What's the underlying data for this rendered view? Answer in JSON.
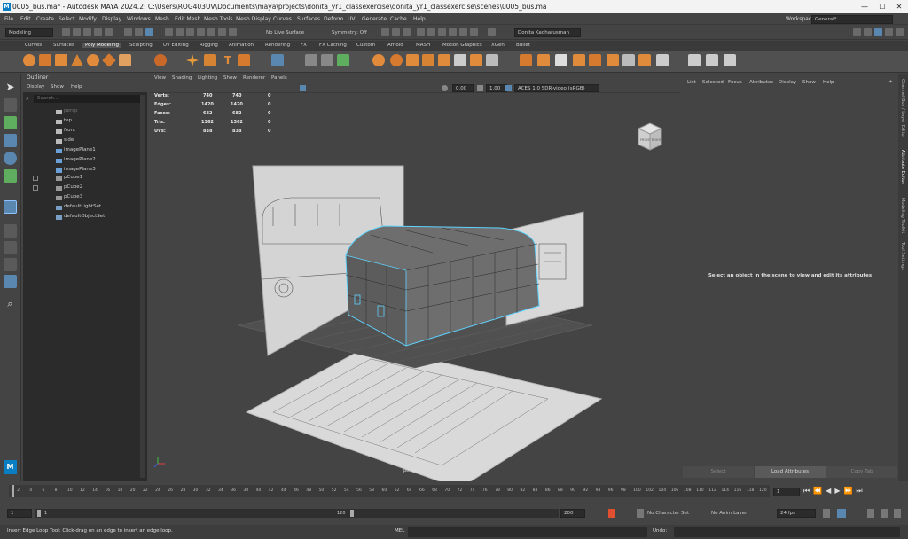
{
  "titlebar": {
    "title": "0005_bus.ma* - Autodesk MAYA 2024.2: C:\\Users\\ROG403UV\\Documents\\maya\\projects\\donita_yr1_classexercise\\donita_yr1_classexercise\\scenes\\0005_bus.ma",
    "logo": "M",
    "minimize": "—",
    "maximize": "☐",
    "close": "✕"
  },
  "menubar": {
    "items": [
      "File",
      "Edit",
      "Create",
      "Select",
      "Modify",
      "Display",
      "Windows",
      "Mesh",
      "Edit Mesh",
      "Mesh Tools",
      "Mesh Display",
      "Curves",
      "Surfaces",
      "Deform",
      "UV",
      "Generate",
      "Cache",
      "Help"
    ],
    "workspace_label": "Workspace:",
    "workspace_value": "General*"
  },
  "statusline": {
    "mode": "Modeling",
    "live_surface": "No Live Surface",
    "symmetry": "Symmetry: Off",
    "user": "Donita Kadharusman"
  },
  "shelf_tabs": [
    "Curves",
    "Surfaces",
    "Poly Modeling",
    "Sculpting",
    "UV Editing",
    "Rigging",
    "Animation",
    "Rendering",
    "FX",
    "FX Caching",
    "Custom",
    "Arnold",
    "MASH",
    "Motion Graphics",
    "XGen",
    "Bullet"
  ],
  "outliner": {
    "title": "Outliner",
    "menu": [
      "Display",
      "Show",
      "Help"
    ],
    "search_placeholder": "Search...",
    "items": [
      "persp",
      "top",
      "front",
      "side",
      "imagePlane1",
      "imagePlane2",
      "imagePlane3",
      "pCube1",
      "pCube2",
      "pCube3",
      "defaultLightSet",
      "defaultObjectSet"
    ]
  },
  "viewport": {
    "menu": [
      "View",
      "Shading",
      "Lighting",
      "Show",
      "Renderer",
      "Panels"
    ],
    "exposure": "0.00",
    "gamma": "1.00",
    "color_space": "ACES 1.0 SDR-video (sRGB)",
    "camera_label": "persp",
    "viewcube_front": "FRONT",
    "viewcube_right": "RIGHT",
    "hud": [
      {
        "label": "Verts:",
        "a": "740",
        "b": "740",
        "c": "0"
      },
      {
        "label": "Edges:",
        "a": "1420",
        "b": "1420",
        "c": "0"
      },
      {
        "label": "Faces:",
        "a": "682",
        "b": "682",
        "c": "0"
      },
      {
        "label": "Tris:",
        "a": "1362",
        "b": "1362",
        "c": "0"
      },
      {
        "label": "UVs:",
        "a": "838",
        "b": "838",
        "c": "0"
      }
    ]
  },
  "attribute_editor": {
    "menu": [
      "List",
      "Selected",
      "Focus",
      "Attributes",
      "Display",
      "Show",
      "Help"
    ],
    "message": "Select an object in the scene to view and edit its attributes",
    "buttons": [
      "Select",
      "Load Attributes",
      "Copy Tab"
    ]
  },
  "right_tabs": [
    "Channel Box / Layer Editor",
    "Attribute Editor",
    "Modeling Toolkit",
    "Tool Settings"
  ],
  "timeslider": {
    "ticks": [
      "1",
      "2",
      "4",
      "6",
      "8",
      "10",
      "12",
      "14",
      "16",
      "18",
      "20",
      "22",
      "24",
      "26",
      "28",
      "30",
      "32",
      "34",
      "36",
      "38",
      "40",
      "42",
      "44",
      "46",
      "48",
      "50",
      "52",
      "54",
      "56",
      "58",
      "60",
      "62",
      "64",
      "66",
      "68",
      "70",
      "72",
      "74",
      "76",
      "78",
      "80",
      "82",
      "84",
      "86",
      "88",
      "90",
      "92",
      "94",
      "96",
      "98",
      "100",
      "102",
      "104",
      "106",
      "108",
      "110",
      "112",
      "114",
      "116",
      "118",
      "120"
    ],
    "current_frame": "1"
  },
  "rangeslider": {
    "start": "1",
    "inner_start": "1",
    "inner_end": "120",
    "end": "200",
    "character_set": "No Character Set",
    "anim_layer": "No Anim Layer",
    "fps": "24 fps"
  },
  "helpline": {
    "message": "Insert Edge Loop Tool: Click-drag on an edge to insert an edge loop.",
    "mel_label": "MEL",
    "undo_label": "Undo:"
  },
  "colors": {
    "accent_blue": "#0a7ec2",
    "shelf_orange": "#e08a3c",
    "wire_cyan": "#5fd3ff"
  }
}
